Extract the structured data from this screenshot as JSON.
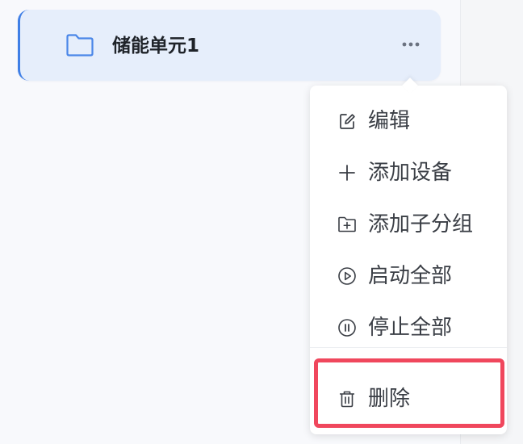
{
  "tree": {
    "item": {
      "label": "储能单元1",
      "icon": "folder-icon",
      "more_icon": "more-horizontal-icon"
    }
  },
  "context_menu": {
    "items": [
      {
        "label": "编辑",
        "icon": "edit-icon"
      },
      {
        "label": "添加设备",
        "icon": "plus-icon"
      },
      {
        "label": "添加子分组",
        "icon": "folder-add-icon"
      },
      {
        "label": "启动全部",
        "icon": "play-circle-icon"
      },
      {
        "label": "停止全部",
        "icon": "pause-circle-icon"
      },
      {
        "label": "删除",
        "icon": "trash-icon"
      }
    ]
  },
  "colors": {
    "accent": "#3f7fe6",
    "selected_bg": "#e6eefb",
    "highlight_border": "#f0475d",
    "text": "#3a3e45"
  }
}
